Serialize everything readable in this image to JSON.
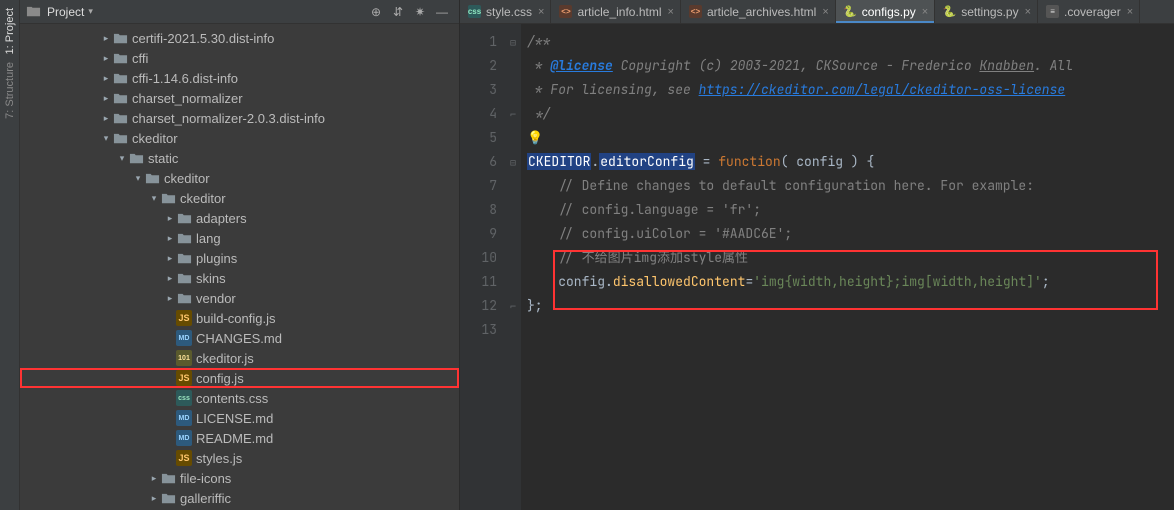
{
  "leftRail": {
    "items": [
      "1: Project",
      "7: Structure"
    ]
  },
  "panel": {
    "title": "Project",
    "toolbarIcons": [
      "target",
      "expand",
      "gear",
      "minimize"
    ]
  },
  "tree": [
    {
      "depth": 5,
      "arrow": "right",
      "kind": "folder",
      "label": "certifi-2021.5.30.dist-info"
    },
    {
      "depth": 5,
      "arrow": "right",
      "kind": "folder",
      "label": "cffi"
    },
    {
      "depth": 5,
      "arrow": "right",
      "kind": "folder",
      "label": "cffi-1.14.6.dist-info"
    },
    {
      "depth": 5,
      "arrow": "right",
      "kind": "folder",
      "label": "charset_normalizer"
    },
    {
      "depth": 5,
      "arrow": "right",
      "kind": "folder",
      "label": "charset_normalizer-2.0.3.dist-info"
    },
    {
      "depth": 5,
      "arrow": "down",
      "kind": "folder",
      "label": "ckeditor"
    },
    {
      "depth": 6,
      "arrow": "down",
      "kind": "folder",
      "label": "static"
    },
    {
      "depth": 7,
      "arrow": "down",
      "kind": "folder",
      "label": "ckeditor"
    },
    {
      "depth": 8,
      "arrow": "down",
      "kind": "folder",
      "label": "ckeditor"
    },
    {
      "depth": 9,
      "arrow": "right",
      "kind": "folder",
      "label": "adapters"
    },
    {
      "depth": 9,
      "arrow": "right",
      "kind": "folder",
      "label": "lang"
    },
    {
      "depth": 9,
      "arrow": "right",
      "kind": "folder",
      "label": "plugins"
    },
    {
      "depth": 9,
      "arrow": "right",
      "kind": "folder",
      "label": "skins"
    },
    {
      "depth": 9,
      "arrow": "right",
      "kind": "folder",
      "label": "vendor"
    },
    {
      "depth": 9,
      "arrow": "none",
      "kind": "js",
      "label": "build-config.js"
    },
    {
      "depth": 9,
      "arrow": "none",
      "kind": "md",
      "label": "CHANGES.md"
    },
    {
      "depth": 9,
      "arrow": "none",
      "kind": "num",
      "label": "ckeditor.js"
    },
    {
      "depth": 9,
      "arrow": "none",
      "kind": "js",
      "label": "config.js",
      "hl": true
    },
    {
      "depth": 9,
      "arrow": "none",
      "kind": "css",
      "label": "contents.css"
    },
    {
      "depth": 9,
      "arrow": "none",
      "kind": "md",
      "label": "LICENSE.md"
    },
    {
      "depth": 9,
      "arrow": "none",
      "kind": "md",
      "label": "README.md"
    },
    {
      "depth": 9,
      "arrow": "none",
      "kind": "js",
      "label": "styles.js"
    },
    {
      "depth": 8,
      "arrow": "right",
      "kind": "folder",
      "label": "file-icons"
    },
    {
      "depth": 8,
      "arrow": "right",
      "kind": "folder",
      "label": "galleriffic"
    }
  ],
  "tabs": [
    {
      "icon": "css",
      "label": "style.css",
      "active": false
    },
    {
      "icon": "html",
      "label": "article_info.html",
      "active": false
    },
    {
      "icon": "html",
      "label": "article_archives.html",
      "active": false
    },
    {
      "icon": "py",
      "label": "configs.py",
      "active": true
    },
    {
      "icon": "py",
      "label": "settings.py",
      "active": false
    },
    {
      "icon": "txt",
      "label": ".coverager",
      "active": false
    }
  ],
  "code": {
    "lines": [
      1,
      2,
      3,
      4,
      5,
      6,
      7,
      8,
      9,
      10,
      11,
      12,
      13
    ],
    "l1_a": "/**",
    "l2_a": " * ",
    "l2_b": "@license",
    "l2_c": " Copyright (c) 2003-2021, CKSource - Frederico ",
    "l2_d": "Knabben",
    "l2_e": ". All ",
    "l3_a": " * For licensing, see ",
    "l3_b": "https://ckeditor.com/legal/ckeditor-oss-license",
    "l4_a": " */",
    "l6_a": "CKEDITOR",
    "l6_b": ".",
    "l6_c": "editorConfig",
    "l6_d": " = ",
    "l6_e": "function",
    "l6_f": "( ",
    "l6_g": "config",
    "l6_h": " ) {",
    "l7_a": "    ",
    "l7_b": "// Define changes to default configuration here. For example:",
    "l8_a": "    ",
    "l8_b": "// config.language = 'fr';",
    "l9_a": "    ",
    "l9_b": "// config.uiColor = '#AADC6E';",
    "l10_a": "    ",
    "l10_b": "// 不给图片img添加style属性",
    "l11_a": "    ",
    "l11_b": "config",
    "l11_c": ".",
    "l11_d": "disallowedContent",
    "l11_e": "=",
    "l11_f": "'img{width,height};img[width,height]'",
    "l11_g": ";",
    "l12_a": "};"
  }
}
